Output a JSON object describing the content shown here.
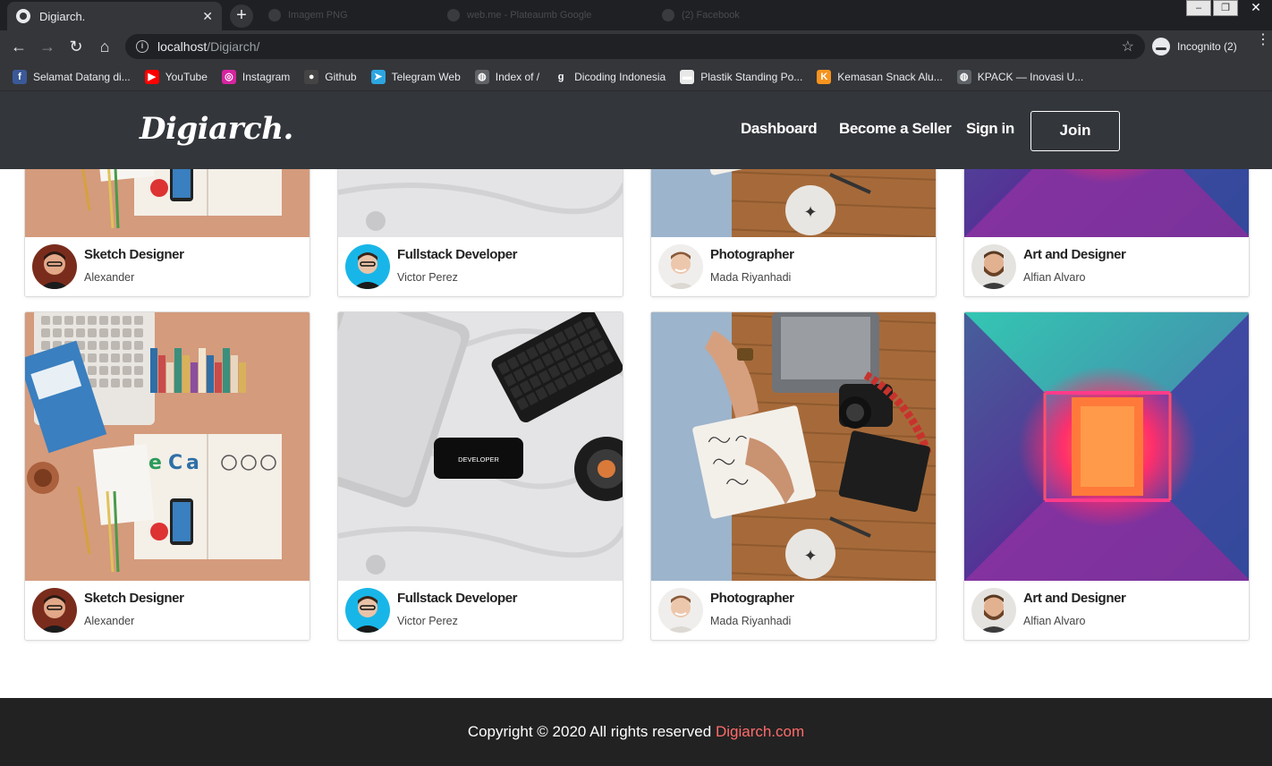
{
  "browser": {
    "tab_title": "Digiarch.",
    "ghost_tabs": [
      "Imagem PNG",
      "web.me - Plateaumb Google",
      "(2) Facebook"
    ],
    "url_host": "localhost",
    "url_path": "/Digiarch/",
    "incognito_label": "Incognito (2)",
    "bookmarks": [
      {
        "label": "Selamat Datang di...",
        "icon": "facebook-icon",
        "color": "#3b5998",
        "glyph": "f"
      },
      {
        "label": "YouTube",
        "icon": "youtube-icon",
        "color": "#ff0000",
        "glyph": "▶"
      },
      {
        "label": "Instagram",
        "icon": "instagram-icon",
        "color": "#d6249f",
        "glyph": "◎"
      },
      {
        "label": "Github",
        "icon": "github-icon",
        "color": "#444444",
        "glyph": "●"
      },
      {
        "label": "Telegram Web",
        "icon": "telegram-icon",
        "color": "#2ca5e0",
        "glyph": "➤"
      },
      {
        "label": "Index of /",
        "icon": "globe-icon",
        "color": "#5f6368",
        "glyph": "◍"
      },
      {
        "label": "Dicoding Indonesia",
        "icon": "dicoding-icon",
        "color": "#35363a",
        "glyph": "g"
      },
      {
        "label": "Plastik Standing Po...",
        "icon": "plastik-icon",
        "color": "#e8e8e8",
        "glyph": "▬"
      },
      {
        "label": "Kemasan Snack Alu...",
        "icon": "kemasan-icon",
        "color": "#f7931e",
        "glyph": "K"
      },
      {
        "label": "KPACK — Inovasi U...",
        "icon": "globe-icon",
        "color": "#5f6368",
        "glyph": "◍"
      }
    ]
  },
  "site": {
    "logo": "Digiarch.",
    "nav": {
      "dashboard": "Dashboard",
      "seller": "Become a Seller",
      "signin": "Sign in",
      "join": "Join"
    }
  },
  "cards": [
    {
      "title": "Sketch Designer",
      "author": "Alexander"
    },
    {
      "title": "Fullstack Developer",
      "author": "Victor Perez"
    },
    {
      "title": "Photographer",
      "author": "Mada Riyanhadi"
    },
    {
      "title": "Art and Designer",
      "author": "Alfian Alvaro"
    },
    {
      "title": "Sketch Designer",
      "author": "Alexander"
    },
    {
      "title": "Fullstack Developer",
      "author": "Victor Perez"
    },
    {
      "title": "Photographer",
      "author": "Mada Riyanhadi"
    },
    {
      "title": "Art and Designer",
      "author": "Alfian Alvaro"
    }
  ],
  "phone_text": "DEVELOPER",
  "footer": {
    "text": "Copyright © 2020 All rights reserved",
    "link": "Digiarch.com",
    "link_color": "#ff6b6b"
  }
}
